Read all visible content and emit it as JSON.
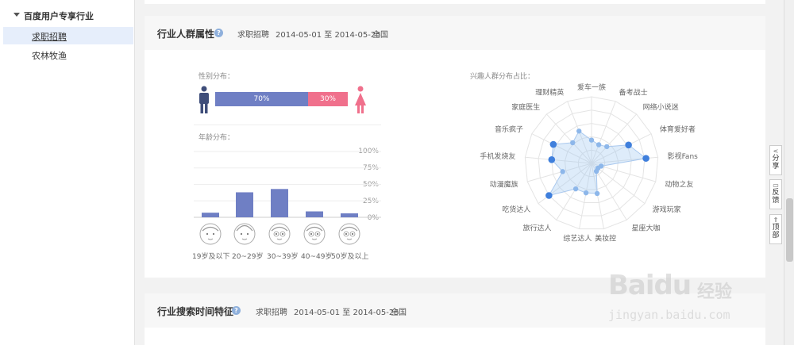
{
  "sidebar": {
    "group_label": "百度用户专享行业",
    "items": [
      {
        "label": "求职招聘",
        "active": true
      },
      {
        "label": "农林牧渔",
        "active": false
      }
    ]
  },
  "panel1": {
    "title": "行业人群属性",
    "help": "?",
    "category": "求职招聘",
    "date_range": "2014-05-01 至 2014-05-25",
    "region": "全国",
    "gender": {
      "label": "性别分布：",
      "male_pct": "70%",
      "female_pct": "30%",
      "male_value": 0.7,
      "female_value": 0.3,
      "male_color": "#6f7fc4",
      "female_color": "#f0708c"
    },
    "age": {
      "label": "年龄分布：",
      "yticks": [
        "100%",
        "75%",
        "50%",
        "25%",
        "0%"
      ],
      "categories": [
        "19岁及以下",
        "20~29岁",
        "30~39岁",
        "40~49岁",
        "50岁及以上"
      ],
      "values": [
        7,
        38,
        43,
        9,
        6
      ],
      "bar_color": "#6f7fc4"
    },
    "interest": {
      "label": "兴趣人群分布占比：",
      "axes": [
        "爱车一族",
        "备考战士",
        "网络小说迷",
        "体育爱好者",
        "影视Fans",
        "动物之友",
        "游戏玩家",
        "星座大咖",
        "美妆控",
        "综艺达人",
        "旅行达人",
        "吃货达人",
        "动漫魔族",
        "手机发烧友",
        "音乐疯子",
        "家庭医生",
        "理财精英"
      ],
      "values": [
        0.35,
        0.3,
        0.34,
        0.62,
        0.82,
        0.15,
        0.12,
        0.14,
        0.46,
        0.45,
        0.45,
        0.8,
        0.45,
        0.6,
        0.64,
        0.42,
        0.52
      ]
    }
  },
  "panel2": {
    "title": "行业搜索时间特征",
    "help": "?",
    "category": "求职招聘",
    "date_range": "2014-05-01 至 2014-05-25",
    "region": "全国"
  },
  "side_tools": [
    {
      "label": "分享",
      "icon": "share-icon"
    },
    {
      "label": "反馈",
      "icon": "feedback-icon"
    },
    {
      "label": "顶部",
      "icon": "to-top-icon"
    }
  ],
  "watermark": {
    "brand": "Baidu",
    "cn": "经验",
    "url": "jingyan.baidu.com"
  }
}
